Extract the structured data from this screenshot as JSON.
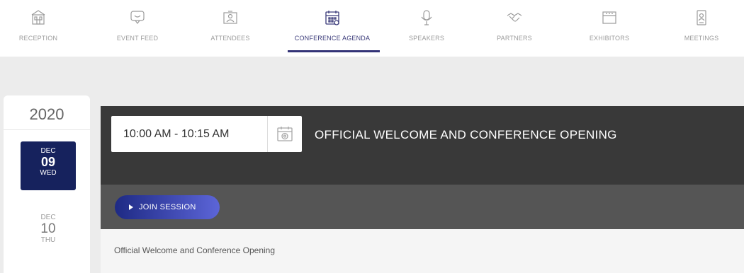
{
  "nav": {
    "items": [
      {
        "label": "RECEPTION",
        "icon": "reception-icon"
      },
      {
        "label": "EVENT FEED",
        "icon": "chat-bubble-icon"
      },
      {
        "label": "ATTENDEES",
        "icon": "attendees-icon"
      },
      {
        "label": "CONFERENCE AGENDA",
        "icon": "calendar-icon"
      },
      {
        "label": "SPEAKERS",
        "icon": "microphone-icon"
      },
      {
        "label": "PARTNERS",
        "icon": "handshake-icon"
      },
      {
        "label": "EXHIBITORS",
        "icon": "booth-icon"
      },
      {
        "label": "MEETINGS",
        "icon": "badge-icon"
      }
    ],
    "active_label": "CONFERENCE AGENDA"
  },
  "dates": {
    "year": "2020",
    "selected": {
      "month": "DEC",
      "day": "09",
      "weekday": "WED"
    },
    "next": {
      "month": "DEC",
      "day": "10",
      "weekday": "THU"
    }
  },
  "session": {
    "time": "10:00 AM - 10:15 AM",
    "title": "OFFICIAL WELCOME AND CONFERENCE OPENING",
    "join_label": "JOIN SESSION",
    "description": "Official Welcome and Conference Opening"
  },
  "colors": {
    "accent": "#333377",
    "active_date": "#16225d",
    "header_dark": "#393939",
    "action_bar": "#555555"
  }
}
